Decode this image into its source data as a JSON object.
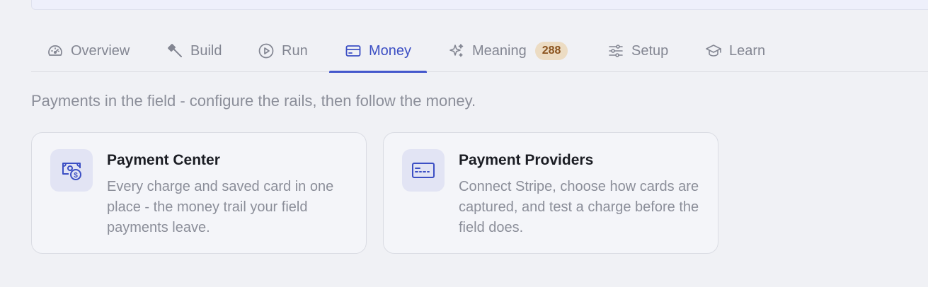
{
  "tabs": [
    {
      "label": "Overview",
      "icon": "gauge-icon"
    },
    {
      "label": "Build",
      "icon": "hammer-icon"
    },
    {
      "label": "Run",
      "icon": "play-circle-icon"
    },
    {
      "label": "Money",
      "icon": "credit-card-icon",
      "active": true
    },
    {
      "label": "Meaning",
      "icon": "sparkles-icon",
      "badge": "288"
    },
    {
      "label": "Setup",
      "icon": "sliders-icon"
    },
    {
      "label": "Learn",
      "icon": "graduation-cap-icon"
    }
  ],
  "subtitle": "Payments in the field - configure the rails, then follow the money.",
  "cards": [
    {
      "title": "Payment Center",
      "description": "Every charge and saved card in one place - the money trail your field payments leave.",
      "icon": "money-dollar-icon"
    },
    {
      "title": "Payment Providers",
      "description": "Connect Stripe, choose how cards are captured, and test a charge before the field does.",
      "icon": "credit-card-icon"
    }
  ],
  "colors": {
    "accent": "#4457cc",
    "badge_bg": "#ecdcc3",
    "badge_text": "#8a531e",
    "background": "#f0f1f5",
    "muted_text": "#838692"
  }
}
